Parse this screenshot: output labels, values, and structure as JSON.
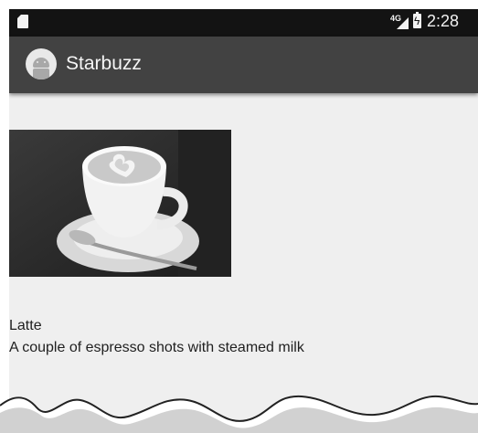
{
  "status_bar": {
    "network": "4G",
    "time": "2:28",
    "icons": [
      "sd-card-icon",
      "signal-icon",
      "battery-charging-icon"
    ]
  },
  "app_bar": {
    "title": "Starbuzz",
    "icon": "android-app-icon"
  },
  "drink": {
    "image_icon": "latte-cup-image",
    "name": "Latte",
    "description": "A couple of espresso shots with steamed milk"
  },
  "colors": {
    "status_bar": "#131313",
    "app_bar": "#424242",
    "background": "#efefef",
    "text": "#1f1f1f"
  }
}
